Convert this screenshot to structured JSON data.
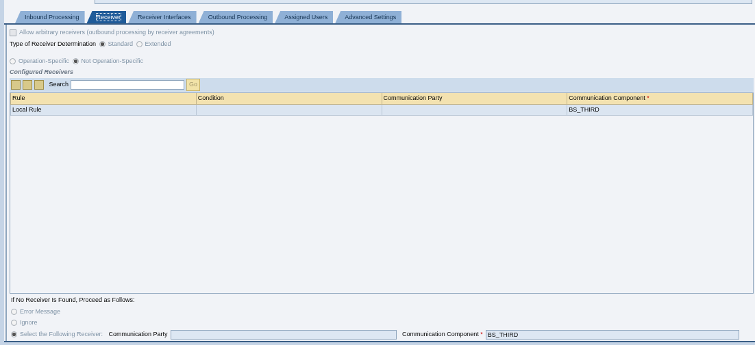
{
  "tabs": [
    {
      "label": "Inbound Processing",
      "selected": false
    },
    {
      "label": "Receiver",
      "selected": true
    },
    {
      "label": "Receiver Interfaces",
      "selected": false
    },
    {
      "label": "Outbound Processing",
      "selected": false
    },
    {
      "label": "Assigned Users",
      "selected": false
    },
    {
      "label": "Advanced Settings",
      "selected": false
    }
  ],
  "allow_arbitrary": {
    "label": "Allow arbitrary receivers (outbound processing by receiver agreements)",
    "checked": false,
    "disabled": true
  },
  "determination": {
    "label": "Type of Receiver Determination",
    "options": [
      {
        "label": "Standard",
        "selected": true,
        "disabled": true
      },
      {
        "label": "Extended",
        "selected": false,
        "disabled": true
      }
    ]
  },
  "operation_options": [
    {
      "label": "Operation-Specific",
      "selected": false,
      "disabled": true
    },
    {
      "label": "Not Operation-Specific",
      "selected": true,
      "disabled": true
    }
  ],
  "configured_receivers": {
    "title": "Configured Receivers",
    "search_label": "Search",
    "go_label": "Go",
    "columns": [
      {
        "label": "Rule"
      },
      {
        "label": "Condition"
      },
      {
        "label": "Communication Party"
      },
      {
        "label": "Communication Component",
        "required_mark": "*"
      }
    ],
    "rows": [
      [
        "Local Rule",
        "",
        "",
        "BS_THIRD"
      ]
    ]
  },
  "fallback": {
    "title": "If No Receiver Is Found, Proceed as Follows:",
    "options": [
      {
        "label": "Error Message",
        "selected": false,
        "disabled": true
      },
      {
        "label": "Ignore",
        "selected": false,
        "disabled": true
      },
      {
        "label": "Select the Following Receiver:",
        "selected": true,
        "disabled": true
      }
    ],
    "fields": [
      {
        "label": "Communication Party"
      },
      {
        "label": "Communication Component",
        "value": "BS_THIRD",
        "required_mark": "*"
      }
    ]
  }
}
